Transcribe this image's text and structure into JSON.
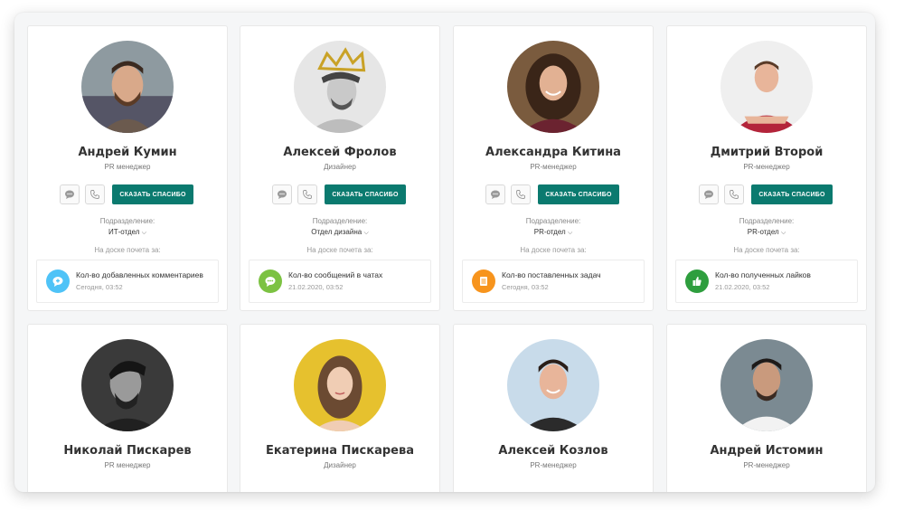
{
  "thanks_label": "Сказать спасибо",
  "dept_label": "Подразделение:",
  "honor_label": "На доске почета за:",
  "top_row": [
    {
      "name": "Андрей Кумин",
      "role": "PR менеджер",
      "department": "ИТ-отдел",
      "award": {
        "title": "Кол-во добавленных комментариев",
        "date": "Сегодня, 03:52",
        "icon": "chat-plus-icon",
        "color": "#4fc3f7"
      }
    },
    {
      "name": "Алексей Фролов",
      "role": "Дизайнер",
      "department": "Отдел дизайна",
      "award": {
        "title": "Кол-во сообщений в чатах",
        "date": "21.02.2020, 03:52",
        "icon": "message-dots-icon",
        "color": "#7cc242"
      }
    },
    {
      "name": "Александра Китина",
      "role": "PR-менеджер",
      "department": "PR-отдел",
      "award": {
        "title": "Кол-во поставленных задач",
        "date": "Сегодня, 03:52",
        "icon": "tasks-icon",
        "color": "#f7941d"
      }
    },
    {
      "name": "Дмитрий Второй",
      "role": "PR-менеджер",
      "department": "PR-отдел",
      "award": {
        "title": "Кол-во полученных лайков",
        "date": "21.02.2020, 03:52",
        "icon": "thumbs-up-icon",
        "color": "#2e9e3e"
      }
    }
  ],
  "bottom_row": [
    {
      "name": "Николай Пискарев",
      "role": "PR менеджер"
    },
    {
      "name": "Екатерина Пискарева",
      "role": "Дизайнер"
    },
    {
      "name": "Алексей Козлов",
      "role": "PR-менеджер"
    },
    {
      "name": "Андрей Истомин",
      "role": "PR-менеджер"
    }
  ],
  "colors": {
    "accent": "#0b7a6f",
    "card_border": "#e8e8e8",
    "background": "#f5f6f7"
  }
}
